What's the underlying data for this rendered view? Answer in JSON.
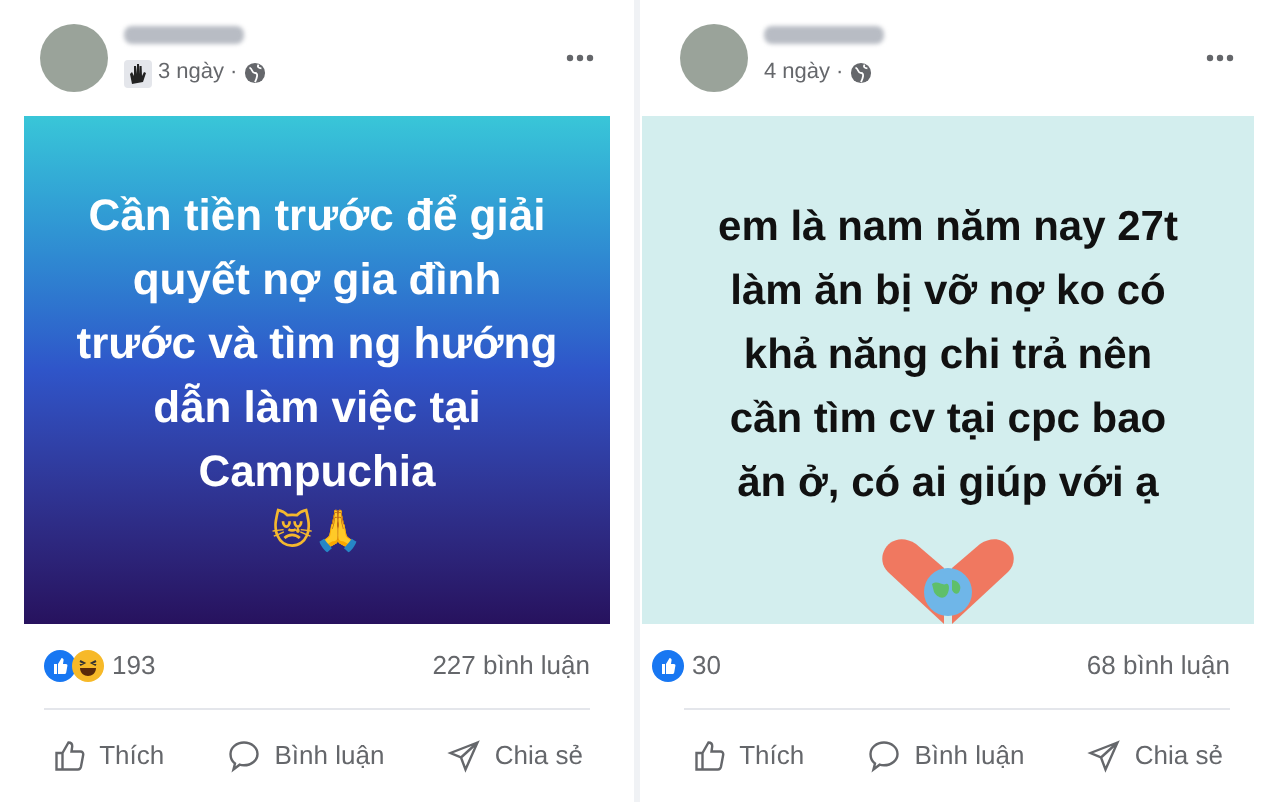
{
  "posts": [
    {
      "time": "3 ngày",
      "separator": "·",
      "badge": true,
      "kind": "gradient",
      "lines": [
        "Cần tiền trước để giải",
        "quyết nợ gia đình",
        "trước và tìm ng hướng",
        "dẫn làm việc tại",
        "Campuchia"
      ],
      "emoji": "😿🙏",
      "art": false,
      "reactions": [
        {
          "kind": "like"
        },
        {
          "kind": "haha"
        }
      ],
      "reaction_count": "193",
      "comments": "227 bình luận",
      "actions": [
        {
          "kind": "like",
          "label": "Thích"
        },
        {
          "kind": "comment",
          "label": "Bình luận"
        },
        {
          "kind": "share",
          "label": "Chia sẻ"
        }
      ]
    },
    {
      "time": "4 ngày",
      "separator": "·",
      "badge": false,
      "kind": "plain",
      "lines": [
        "em là nam năm nay 27t",
        "làm ăn bị vỡ nợ ko có",
        "khả năng chi trả nên",
        "cần tìm cv tại cpc bao",
        "ăn ở, có ai giúp với ạ"
      ],
      "art": true,
      "reactions": [
        {
          "kind": "like"
        }
      ],
      "reaction_count": "30",
      "comments": "68 bình luận",
      "actions": [
        {
          "kind": "like",
          "label": "Thích"
        },
        {
          "kind": "comment",
          "label": "Bình luận"
        },
        {
          "kind": "share",
          "label": "Chia sẻ"
        }
      ]
    }
  ]
}
